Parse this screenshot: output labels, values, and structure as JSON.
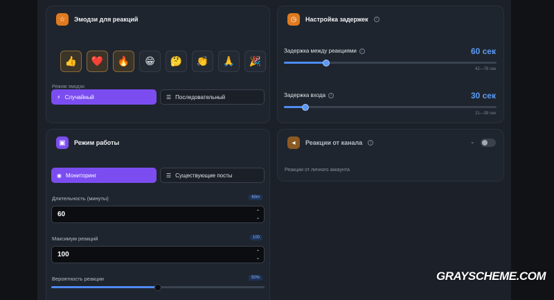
{
  "emoji_card": {
    "title": "Эмодзи для реакций",
    "icon": "star-icon",
    "emojis": [
      {
        "glyph": "👍",
        "selected": true
      },
      {
        "glyph": "❤️",
        "selected": true
      },
      {
        "glyph": "🔥",
        "selected": true
      },
      {
        "glyph": "😁",
        "selected": false
      },
      {
        "glyph": "🤔",
        "selected": false
      },
      {
        "glyph": "👏",
        "selected": false
      },
      {
        "glyph": "🙏",
        "selected": false
      },
      {
        "glyph": "🎉",
        "selected": false
      }
    ],
    "mode_label": "Режим эмодзи",
    "mode_random": "Случайный",
    "mode_sequential": "Последовательный"
  },
  "delays_card": {
    "title": "Настройка задержек",
    "icon": "clock-icon",
    "reaction_delay_label": "Задержка между реакциями",
    "reaction_delay_value": "60 сек",
    "reaction_delay_range": "42—78 сек",
    "reaction_delay_fraction": 0.2,
    "join_delay_label": "Задержка входа",
    "join_delay_value": "30 сек",
    "join_delay_range": "21—39 сек",
    "join_delay_fraction": 0.1
  },
  "work_mode_card": {
    "title": "Режим работы",
    "icon": "settings-icon",
    "mode_monitoring": "Мониторинг",
    "mode_existing": "Существующие посты",
    "duration_label": "Длительность (минуты)",
    "duration_badge": "60m",
    "duration_value": "60",
    "max_reactions_label": "Максимум реакций",
    "max_reactions_badge": "100",
    "max_reactions_value": "100",
    "probability_label": "Вероятность реакции",
    "probability_badge": "50%",
    "probability_fraction": 0.5
  },
  "channel_card": {
    "title": "Реакции от канала",
    "icon": "megaphone-icon",
    "subtitle": "Реакции от личного аккаунта",
    "toggle_on": false
  },
  "watermark": "GRAYSCHEME.COM",
  "colors": {
    "accent_purple": "#7b4df0",
    "accent_blue": "#5b9bf7",
    "accent_orange": "#e07a1f"
  }
}
